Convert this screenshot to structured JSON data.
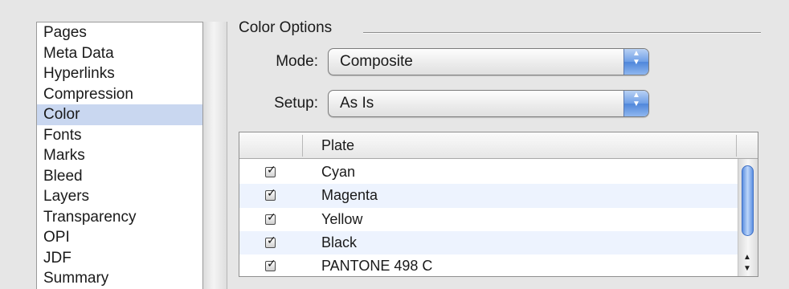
{
  "categories": [
    {
      "label": "Pages",
      "selected": false
    },
    {
      "label": "Meta Data",
      "selected": false
    },
    {
      "label": "Hyperlinks",
      "selected": false
    },
    {
      "label": "Compression",
      "selected": false
    },
    {
      "label": "Color",
      "selected": true
    },
    {
      "label": "Fonts",
      "selected": false
    },
    {
      "label": "Marks",
      "selected": false
    },
    {
      "label": "Bleed",
      "selected": false
    },
    {
      "label": "Layers",
      "selected": false
    },
    {
      "label": "Transparency",
      "selected": false
    },
    {
      "label": "OPI",
      "selected": false
    },
    {
      "label": "JDF",
      "selected": false
    },
    {
      "label": "Summary",
      "selected": false
    }
  ],
  "color_options": {
    "title": "Color Options",
    "mode": {
      "label": "Mode:",
      "value": "Composite"
    },
    "setup": {
      "label": "Setup:",
      "value": "As Is"
    },
    "plates": {
      "column_header": "Plate",
      "rows": [
        {
          "name": "Cyan",
          "checked": true
        },
        {
          "name": "Magenta",
          "checked": true
        },
        {
          "name": "Yellow",
          "checked": true
        },
        {
          "name": "Black",
          "checked": true
        },
        {
          "name": "PANTONE 498 C",
          "checked": true
        }
      ]
    }
  },
  "icons": {
    "popup_arrows": "up-down-chevron-icon",
    "checkbox": "check-icon",
    "scroll_up": "scroll-up-arrow-icon",
    "scroll_down": "scroll-down-arrow-icon"
  },
  "colors": {
    "selection": "#c9d7f0",
    "alt_row": "#edf3fe",
    "aqua_accent": "#4f86da"
  }
}
